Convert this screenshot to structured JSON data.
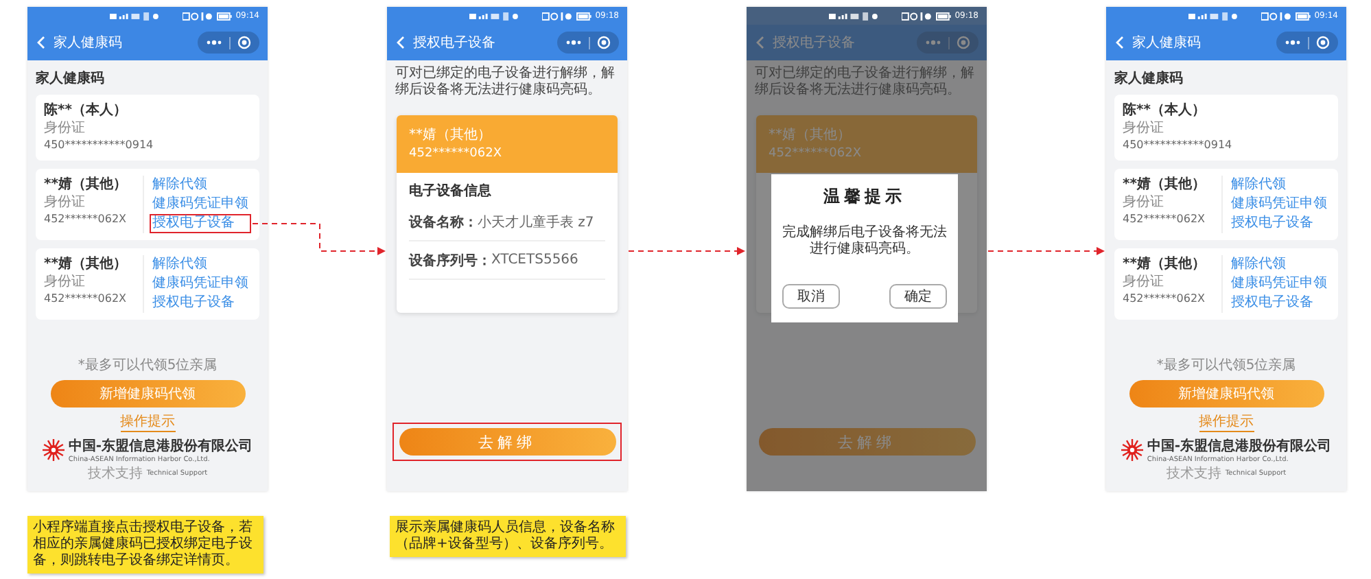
{
  "screens": [
    {
      "kind": "family_list",
      "status_time": "09:14",
      "title": "家人健康码",
      "heading": "家人健康码",
      "members": [
        {
          "name": "陈**（本人）",
          "id_type": "身份证",
          "id_number": "450***********0914"
        },
        {
          "name": "**婧（其他）",
          "id_type": "身份证",
          "id_number": "452******062X",
          "actions": [
            {
              "label": "解除代领",
              "highlighted": false
            },
            {
              "label": "健康码凭证申领",
              "highlighted": false
            },
            {
              "label": "授权电子设备",
              "highlighted": true
            }
          ]
        },
        {
          "name": "**婧（其他）",
          "id_type": "身份证",
          "id_number": "452******062X",
          "actions": [
            {
              "label": "解除代领",
              "highlighted": false
            },
            {
              "label": "健康码凭证申领",
              "highlighted": false
            },
            {
              "label": "授权电子设备",
              "highlighted": false
            }
          ]
        }
      ],
      "limit_note": "*最多可以代领5位亲属",
      "add_button": "新增健康码代领",
      "help_link": "操作提示",
      "company_name": "中国-东盟信息港股份有限公司",
      "company_name_en": "China-ASEAN Information Harbor Co.,Ltd.",
      "support_label": "技术支持",
      "support_label_en": "Technical Support"
    },
    {
      "kind": "device_detail",
      "status_time": "09:18",
      "title": "授权电子设备",
      "description": "可对已绑定的电子设备进行解绑，解绑后设备将无法进行健康码亮码。",
      "member_name": "**婧（其他）",
      "member_id": "452******062X",
      "section_title": "电子设备信息",
      "fields": [
        {
          "label": "设备名称：",
          "value": "小天才儿童手表 z7"
        },
        {
          "label": "设备序列号：",
          "value": "XTCETS5566"
        }
      ],
      "unbind_button": "去解绑",
      "button_highlighted": true
    },
    {
      "kind": "device_detail",
      "status_time": "09:18",
      "title": "授权电子设备",
      "description": "可对已绑定的电子设备进行解绑，解绑后设备将无法进行健康码亮码。",
      "member_name": "**婧（其他）",
      "member_id": "452******062X",
      "unbind_button": "去解绑",
      "button_highlighted": false,
      "dialog": {
        "title": "温馨提示",
        "message": "完成解绑后电子设备将无法进行健康码亮码。",
        "buttons": [
          "取消",
          "确定"
        ]
      }
    },
    {
      "kind": "family_list",
      "status_time": "09:14",
      "title": "家人健康码",
      "heading": "家人健康码",
      "members": [
        {
          "name": "陈**（本人）",
          "id_type": "身份证",
          "id_number": "450***********0914"
        },
        {
          "name": "**婧（其他）",
          "id_type": "身份证",
          "id_number": "452******062X",
          "actions": [
            {
              "label": "解除代领",
              "highlighted": false
            },
            {
              "label": "健康码凭证申领",
              "highlighted": false
            },
            {
              "label": "授权电子设备",
              "highlighted": false
            }
          ]
        },
        {
          "name": "**婧（其他）",
          "id_type": "身份证",
          "id_number": "452******062X",
          "actions": [
            {
              "label": "解除代领",
              "highlighted": false
            },
            {
              "label": "健康码凭证申领",
              "highlighted": false
            },
            {
              "label": "授权电子设备",
              "highlighted": false
            }
          ]
        }
      ],
      "limit_note": "*最多可以代领5位亲属",
      "add_button": "新增健康码代领",
      "help_link": "操作提示",
      "company_name": "中国-东盟信息港股份有限公司",
      "company_name_en": "China-ASEAN Information Harbor Co.,Ltd.",
      "support_label": "技术支持",
      "support_label_en": "Technical Support"
    }
  ],
  "notes": [
    {
      "text": "小程序端直接点击授权电子设备，若相应的亲属健康码已授权绑定电子设备，则跳转电子设备绑定详情页。"
    },
    {
      "text": "展示亲属健康码人员信息，设备名称（品牌+设备型号）、设备序列号。"
    }
  ]
}
